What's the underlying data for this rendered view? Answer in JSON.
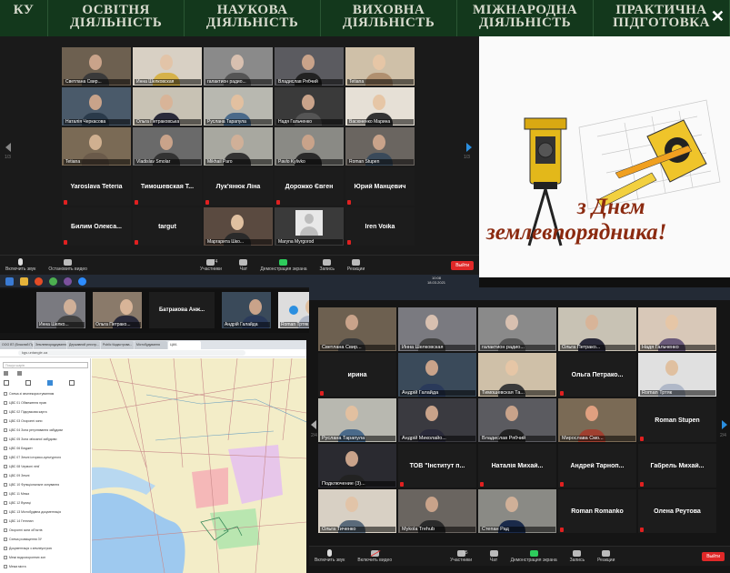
{
  "nav": {
    "items": [
      "ку",
      "Освітня діяльність",
      "Наукова діяльність",
      "Виховна діяльність",
      "Міжнародна діяльність",
      "Практична підготовка"
    ],
    "close_glyph": "✕"
  },
  "zoom1": {
    "tiles": [
      {
        "name": "Светлана Свир...",
        "kind": "video",
        "bg": "#6d6050",
        "skin": "#c9a38a",
        "shirt": "#3a3a3a"
      },
      {
        "name": "Инна Шелковская",
        "kind": "video",
        "bg": "#d8d0c4",
        "skin": "#e2c4a8",
        "shirt": "#d6b24a"
      },
      {
        "name": "галактион радио...",
        "kind": "video",
        "bg": "#8a8a8a",
        "skin": "#d8c0b0",
        "shirt": "#555"
      },
      {
        "name": "Владислав Рябчий",
        "kind": "video",
        "bg": "#5b5b60",
        "skin": "#c9a38a",
        "shirt": "#222"
      },
      {
        "name": "Tetiana",
        "kind": "video",
        "bg": "#cfc0a8",
        "skin": "#e6c6a6",
        "shirt": "#b09070"
      },
      {
        "name": "Наталія Черкасова",
        "kind": "video",
        "bg": "#4a5a6a",
        "skin": "#c9a38a",
        "shirt": "#2a3a4a"
      },
      {
        "name": "Ольга Петраковська",
        "kind": "video",
        "bg": "#c8c2b4",
        "skin": "#d8b498",
        "shirt": "#2a2a3a",
        "highlight": true
      },
      {
        "name": "Руслана Тарапула",
        "kind": "video",
        "bg": "#b8b8b0",
        "skin": "#e2c0a0",
        "shirt": "#4a6a8a"
      },
      {
        "name": "Надя Гальченко",
        "kind": "video",
        "bg": "#3a3a3a",
        "skin": "#c9a38a",
        "shirt": "#555"
      },
      {
        "name": "Васюненко Марина",
        "kind": "video",
        "bg": "#e6e0d6",
        "skin": "#e6c6a6",
        "shirt": "#333"
      },
      {
        "name": "Tetiana",
        "kind": "video",
        "bg": "#7a6a55",
        "skin": "#d0b090",
        "shirt": "#6a5a4a"
      },
      {
        "name": "Vladislav Smolar",
        "kind": "video",
        "bg": "#6a6a6a",
        "skin": "#c9a38a",
        "shirt": "#333"
      },
      {
        "name": "Mikhail Paro",
        "kind": "video",
        "bg": "#a8a8a0",
        "skin": "#d0b098",
        "shirt": "#333"
      },
      {
        "name": "Pavlo Kylivko",
        "kind": "video",
        "bg": "#8a8a85",
        "skin": "#c9a38a",
        "shirt": "#2a2a2a"
      },
      {
        "name": "Roman Stupen",
        "kind": "video",
        "bg": "#6a6560",
        "skin": "#c9a38a",
        "shirt": "#3a4a5a"
      },
      {
        "name": "Yaroslava Teteria",
        "kind": "text"
      },
      {
        "name": "Тимошевская Т...",
        "kind": "text"
      },
      {
        "name": "Лук'янюк Ліна",
        "kind": "text"
      },
      {
        "name": "Дорожко Євген",
        "kind": "text"
      },
      {
        "name": "Юрий Манцевич",
        "kind": "text"
      },
      {
        "name": "Билим Олекса...",
        "kind": "text"
      },
      {
        "name": "targut",
        "kind": "text"
      },
      {
        "name": "Маргарита Шко...",
        "kind": "video",
        "bg": "#5a4a40",
        "skin": "#e0c0a0",
        "shirt": "#2a2a2a"
      },
      {
        "name": "Maryna Myrgorod",
        "kind": "avatar"
      },
      {
        "name": "Iren Voika",
        "kind": "text"
      }
    ],
    "page_left": "1/3",
    "page_right": "1/3",
    "toolbar": {
      "unmute": "Включить звук",
      "start_video": "Остановить видео",
      "participants": "Участники",
      "participants_count": "74",
      "chat": "Чат",
      "share": "Демонстрация экрана",
      "record": "Запись",
      "reactions": "Реакции",
      "end": "Выйти"
    }
  },
  "card": {
    "line1": "з Днем",
    "line2": "землевпорядника!"
  },
  "taskbar": {
    "time": "10:08",
    "date": "18.03.2021"
  },
  "left2": {
    "strip": [
      {
        "name": "Инна Шелко...",
        "kind": "video",
        "bg": "#7a7a80",
        "skin": "#d0b098",
        "shirt": "#444"
      },
      {
        "name": "Ольга Петрако...",
        "kind": "video",
        "bg": "#8a7a6a",
        "skin": "#d8b498",
        "shirt": "#2a2a3a"
      },
      {
        "name": "Батракова Анж...",
        "kind": "text"
      },
      {
        "name": "Андрій Галайда",
        "kind": "video",
        "bg": "#3a4a5a",
        "skin": "#c9a38a",
        "shirt": "#2a3a5a"
      },
      {
        "name": "Roman Тртяк",
        "kind": "video",
        "bg": "#ddd",
        "skin": "#e0c0a0",
        "shirt": "#b0b8c8"
      }
    ],
    "browser": {
      "tabs": [
        "ООО ВТ (Власний Прос...",
        "Землевпорядкування...",
        "Державний реєстр...",
        "Public Кадастрова...",
        "Містобудування",
        "ЦИА"
      ],
      "url": "kgs.untangle.ua",
      "search_placeholder": "Пошук шарів",
      "layers": [
        "Схема зі землекористуванням",
        "ЦВС 01 Обмеження прав",
        "ЦВС 02 Підсумкова карта",
        "ЦВС 03 Охоронні зони",
        "ЦВС 04 Зона регулювання забудови",
        "ЦВС 05 Зона зв'язаної забудови",
        "ЦВС 06 Бюджет",
        "ЦВС 07 Землі історико-культурного",
        "ЦВС 08 Червоні лінії",
        "ЦВС 09 Землі",
        "ЦВС 10 Функціональне зонування",
        "ЦВС 11 Межа",
        "ЦВС 12 Вулиці",
        "ЦВС 13 Містобудівна документація",
        "ЦВС 14 Генплан",
        "Охоронні зони об'єктів",
        "Схема розміщення ЗУ",
        "Документація з землеустрою",
        "Межі водоохоронних зон",
        "Межа міста",
        "Кадастрова карта"
      ]
    }
  },
  "zoom2": {
    "tiles": [
      {
        "name": "Светлана Свир...",
        "kind": "video",
        "bg": "#6d6050",
        "skin": "#c9a38a",
        "shirt": "#3a3a3a"
      },
      {
        "name": "Инна Шелковская",
        "kind": "video",
        "bg": "#7a7a80",
        "skin": "#d8c0b0",
        "shirt": "#444"
      },
      {
        "name": "галактион радио...",
        "kind": "video",
        "bg": "#8a8a8a",
        "skin": "#d8c0b0",
        "shirt": "#555"
      },
      {
        "name": "Ольга Петрако...",
        "kind": "video",
        "bg": "#c8c2b4",
        "skin": "#d8b498",
        "shirt": "#2a2a3a"
      },
      {
        "name": "Надя Гальченко",
        "kind": "video",
        "bg": "#d8c8b8",
        "skin": "#e6c6a6",
        "shirt": "#6a5a7a"
      },
      {
        "name": "ирина",
        "kind": "text"
      },
      {
        "name": "Андрій Галайда",
        "kind": "video",
        "bg": "#3a4a5a",
        "skin": "#c9a38a",
        "shirt": "#2a3a5a"
      },
      {
        "name": "Тимошевская Та...",
        "kind": "video",
        "bg": "#cfc0a8",
        "skin": "#e6c6a6",
        "shirt": "#3a3a3a"
      },
      {
        "name": "Ольга Петрако...",
        "kind": "text"
      },
      {
        "name": "Roman Тртяк",
        "kind": "video",
        "bg": "#e0e0e0",
        "skin": "#e0c0a0",
        "shirt": "#b0b8c8"
      },
      {
        "name": "Руслана Тарапула",
        "kind": "video",
        "bg": "#b8b8b0",
        "skin": "#e2c0a0",
        "shirt": "#4a6a8a"
      },
      {
        "name": "Андрій Миколайо...",
        "kind": "video",
        "bg": "#3a3a40",
        "skin": "#c9a38a",
        "shirt": "#2a2a3a",
        "highlight": true
      },
      {
        "name": "Владислав Рябчий",
        "kind": "video",
        "bg": "#5b5b60",
        "skin": "#c9a38a",
        "shirt": "#222"
      },
      {
        "name": "Мирослава Смо...",
        "kind": "video",
        "bg": "#7a6a55",
        "skin": "#e0a080",
        "shirt": "#a04030"
      },
      {
        "name": "Roman Stupen",
        "kind": "text"
      },
      {
        "name": "Подключение (3)...",
        "kind": "video",
        "bg": "#2a2a30",
        "skin": "#c9a38a",
        "shirt": "#222"
      },
      {
        "name": "ТОВ \"Інститут п...",
        "kind": "text"
      },
      {
        "name": "Наталія Михай...",
        "kind": "text"
      },
      {
        "name": "Андрей Тарноп...",
        "kind": "text"
      },
      {
        "name": "Габрель Михай...",
        "kind": "text"
      },
      {
        "name": "Ольга Тиченко",
        "kind": "video",
        "bg": "#d8d0c4",
        "skin": "#e2c4a8",
        "shirt": "#5a6a7a"
      },
      {
        "name": "Mykola Trehub",
        "kind": "video",
        "bg": "#6a6560",
        "skin": "#c9a38a",
        "shirt": "#2a2a2a"
      },
      {
        "name": "Степан Рад",
        "kind": "video",
        "bg": "#8a8a85",
        "skin": "#d0b098",
        "shirt": "#1a2a4a"
      },
      {
        "name": "Roman Romanko",
        "kind": "text"
      },
      {
        "name": "Олена Реутова",
        "kind": "text"
      }
    ],
    "page_left": "2/4",
    "page_right": "2/4",
    "toolbar": {
      "unmute": "Включить звук",
      "start_video": "Включить видео",
      "participants": "Участники",
      "participants_count": "85",
      "chat": "Чат",
      "share": "Демонстрация экрана",
      "record": "Запись",
      "reactions": "Реакции",
      "end": "Выйти"
    }
  }
}
